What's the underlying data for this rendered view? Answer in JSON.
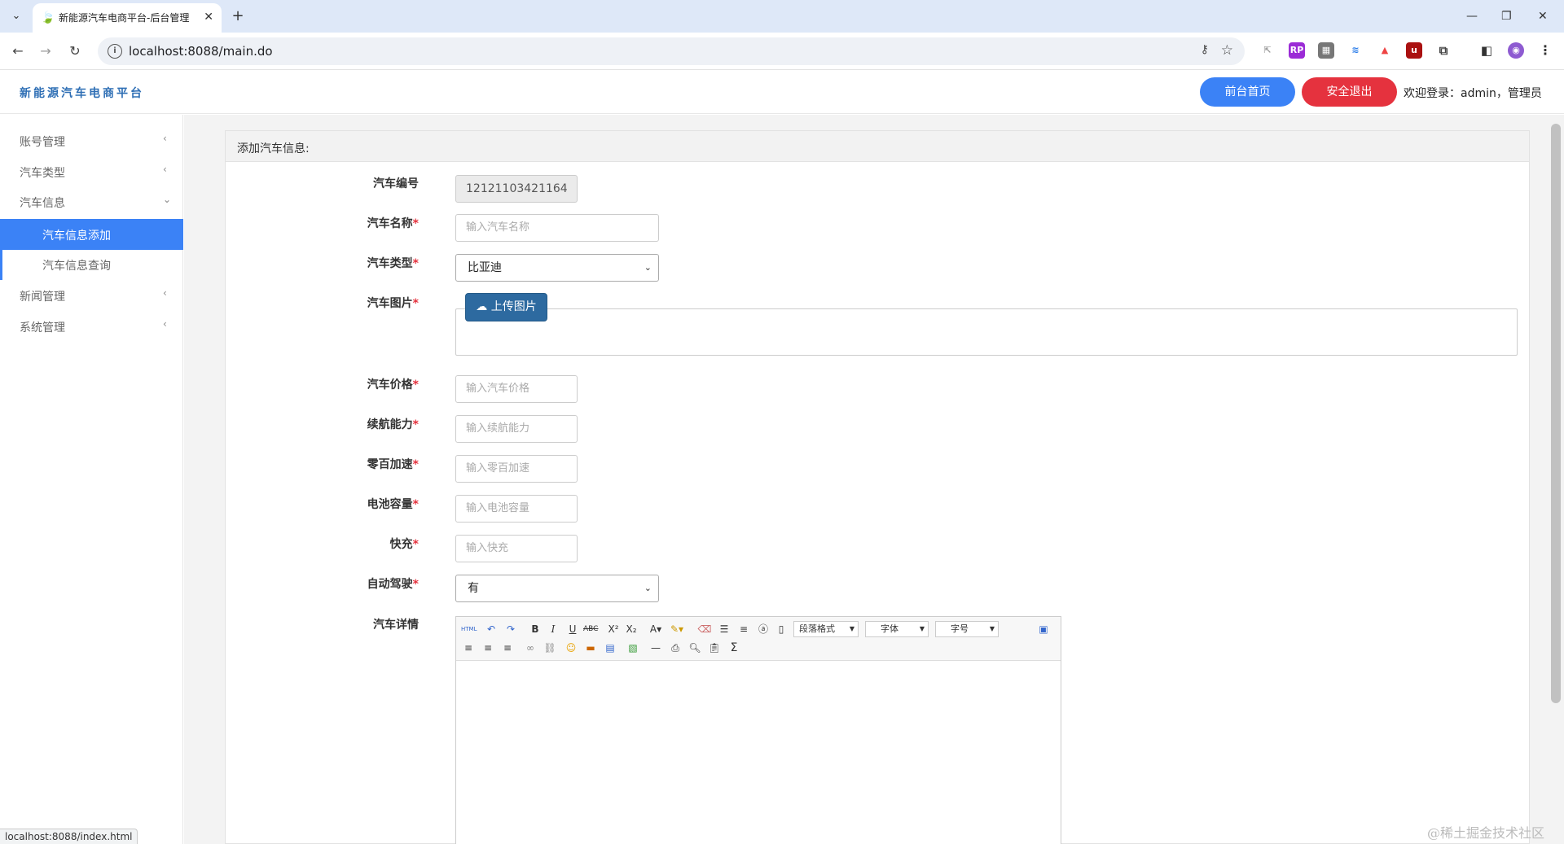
{
  "browser": {
    "tab_title": "新能源汽车电商平台-后台管理",
    "url": "localhost:8088/main.do",
    "status_url": "localhost:8088/index.html"
  },
  "header": {
    "brand": "新能源汽车电商平台",
    "front_button": "前台首页",
    "logout_button": "安全退出",
    "welcome": "欢迎登录：admin，管理员"
  },
  "sidebar": {
    "items": [
      {
        "label": "账号管理"
      },
      {
        "label": "汽车类型"
      },
      {
        "label": "汽车信息"
      },
      {
        "label": "汽车信息添加"
      },
      {
        "label": "汽车信息查询"
      },
      {
        "label": "新闻管理"
      },
      {
        "label": "系统管理"
      }
    ]
  },
  "form": {
    "panel_title": "添加汽车信息:",
    "car_id": {
      "label": "汽车编号",
      "value": "12121103421164"
    },
    "car_name": {
      "label": "汽车名称",
      "placeholder": "输入汽车名称"
    },
    "car_type": {
      "label": "汽车类型",
      "selected": "比亚迪"
    },
    "car_image": {
      "label": "汽车图片",
      "upload_button": "上传图片"
    },
    "car_price": {
      "label": "汽车价格",
      "placeholder": "输入汽车价格"
    },
    "range": {
      "label": "续航能力",
      "placeholder": "输入续航能力"
    },
    "acceleration": {
      "label": "零百加速",
      "placeholder": "输入零百加速"
    },
    "battery": {
      "label": "电池容量",
      "placeholder": "输入电池容量"
    },
    "fast_charge": {
      "label": "快充",
      "placeholder": "输入快充"
    },
    "autopilot": {
      "label": "自动驾驶",
      "selected": "有"
    },
    "details": {
      "label": "汽车详情"
    },
    "required_mark": "*"
  },
  "editor": {
    "paragraph_format": "段落格式",
    "font_family": "字体",
    "font_size": "字号"
  },
  "watermark": "@稀土掘金技术社区"
}
